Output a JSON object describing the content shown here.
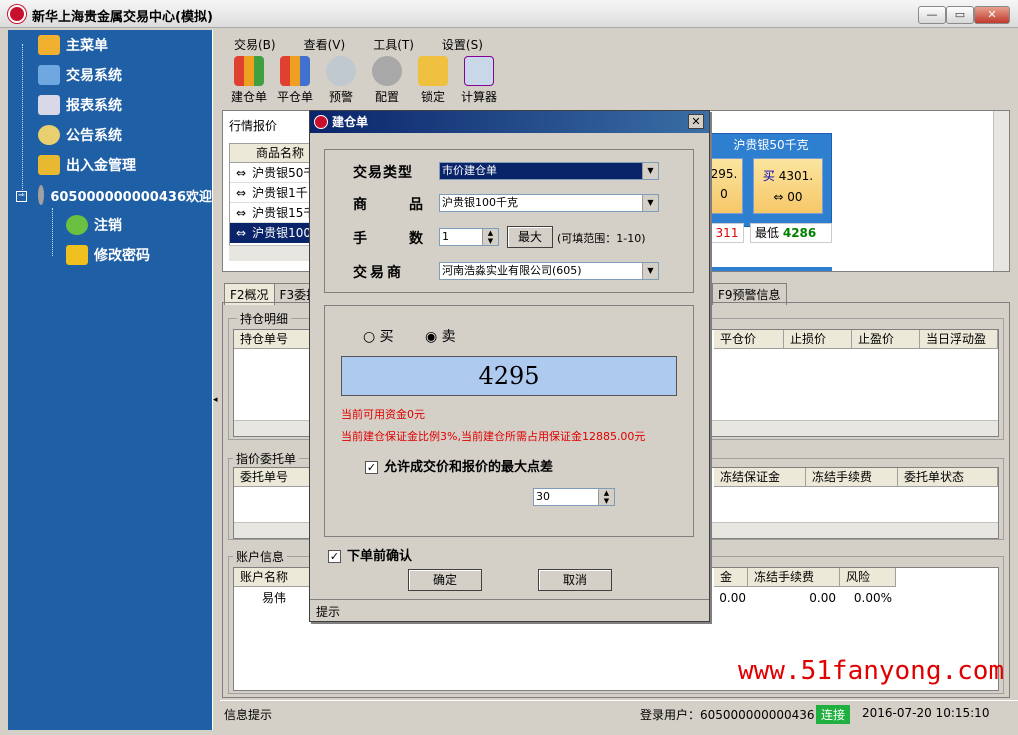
{
  "window": {
    "title": "新华上海贵金属交易中心(模拟)",
    "min": "—",
    "max": "▭",
    "close": "✕"
  },
  "sidebar": {
    "items": [
      {
        "label": "主菜单",
        "icon": "home-icon"
      },
      {
        "label": "交易系统",
        "icon": "monitor-icon"
      },
      {
        "label": "报表系统",
        "icon": "chart-icon"
      },
      {
        "label": "公告系统",
        "icon": "chat-icon"
      },
      {
        "label": "出入金管理",
        "icon": "coins-icon"
      }
    ],
    "account": {
      "label": "605000000000436欢迎",
      "icon": "cup-icon"
    },
    "children": [
      {
        "label": "注销",
        "icon": "user-icon"
      },
      {
        "label": "修改密码",
        "icon": "key-icon"
      }
    ]
  },
  "menu": [
    "交易(B)",
    "查看(V)",
    "工具(T)",
    "设置(S)"
  ],
  "toolbar": [
    "建仓单",
    "平仓单",
    "预警",
    "配置",
    "锁定",
    "计算器"
  ],
  "quotes": {
    "panel_title": "行情报价",
    "col_header": "商品名称",
    "rows": [
      "沪贵银50千",
      "沪贵银1千",
      "沪贵银15千",
      "沪贵银100"
    ],
    "card_title": "沪贵银50千克",
    "sell_partial": "295.",
    "buy_label": "买",
    "buy_price": "4301.",
    "arrow_zero": "00",
    "zero_left": "0",
    "low_label": "最低",
    "low_value": "4286",
    "red_partial": "311"
  },
  "tabs": [
    "F2概况",
    "F3委托",
    "F9预警信息"
  ],
  "holdings": {
    "title": "持仓明细",
    "col0": "持仓单号",
    "cols": [
      "平仓价",
      "止损价",
      "止盈价",
      "当日浮动盈"
    ]
  },
  "orders": {
    "title": "指价委托单",
    "col0": "委托单号",
    "cols": [
      "冻结保证金",
      "冻结手续费",
      "委托单状态"
    ]
  },
  "account_info": {
    "title": "账户信息",
    "col0": "账户名称",
    "name": "易伟",
    "cols": [
      "金",
      "冻结手续费",
      "风险"
    ],
    "values": [
      "0.00",
      "0.00",
      "0.00%"
    ]
  },
  "status": {
    "tip": "信息提示",
    "login_user_label": "登录用户：605000000000436",
    "conn": "连接",
    "time": "2016-07-20 10:15:10"
  },
  "watermark": "www.51fanyong.com",
  "dialog": {
    "title": "建仓单",
    "trade_type_label": "交易类型",
    "trade_type": "市价建仓单",
    "product_label": "商　品",
    "product": "沪贵银100千克",
    "qty_label": "手　数",
    "qty": "1",
    "max_btn": "最大",
    "range": "(可填范围：1-10)",
    "dealer_label": "交易商",
    "dealer": "河南浩淼实业有限公司(605)",
    "buy": "买",
    "sell": "卖",
    "price": "4295",
    "fund_msg": "当前可用资金0元",
    "margin_msg": "当前建仓保证金比例3%,当前建仓所需占用保证金12885.00元",
    "allow_label": "允许成交价和报价的最大点差",
    "spread": "30",
    "confirm_label": "下单前确认",
    "ok": "确定",
    "cancel": "取消",
    "hint": "提示"
  }
}
